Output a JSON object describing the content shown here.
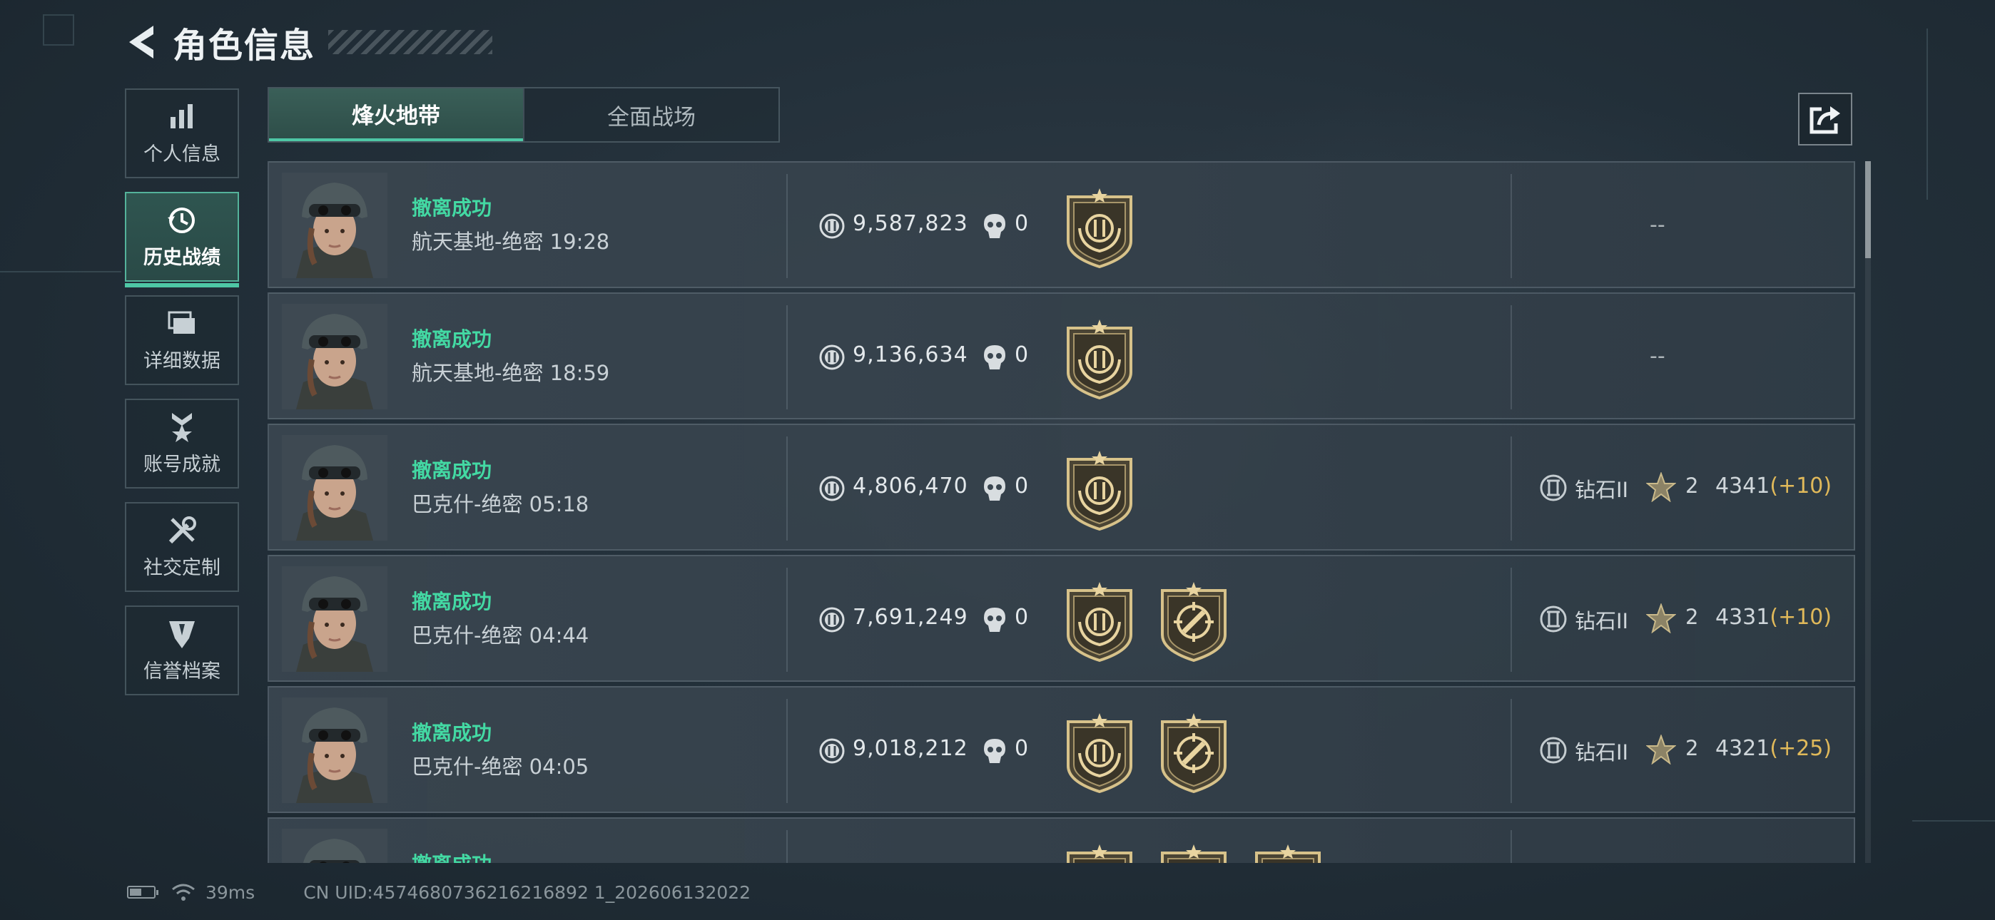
{
  "header": {
    "title": "角色信息",
    "back_icon": "back-arrow-icon"
  },
  "sidebar": {
    "items": [
      {
        "label": "个人信息",
        "icon": "bar-chart-icon",
        "active": false
      },
      {
        "label": "历史战绩",
        "icon": "history-clock-icon",
        "active": true
      },
      {
        "label": "详细数据",
        "icon": "folder-stack-icon",
        "active": false
      },
      {
        "label": "账号成就",
        "icon": "achievement-medal-icon",
        "active": false
      },
      {
        "label": "社交定制",
        "icon": "tools-icon",
        "active": false
      },
      {
        "label": "信誉档案",
        "icon": "credit-shield-icon",
        "active": false
      }
    ]
  },
  "tabs": [
    {
      "label": "烽火地带",
      "active": true
    },
    {
      "label": "全面战场",
      "active": false
    }
  ],
  "share_icon": "share-export-icon",
  "records": [
    {
      "status": "撤离成功",
      "map": "航天基地-绝密 19:28",
      "money": "9,587,823",
      "kills": "0",
      "medals": [
        "laurel-medal"
      ],
      "rank": null,
      "dash": "--"
    },
    {
      "status": "撤离成功",
      "map": "航天基地-绝密 18:59",
      "money": "9,136,634",
      "kills": "0",
      "medals": [
        "laurel-medal"
      ],
      "rank": null,
      "dash": "--"
    },
    {
      "status": "撤离成功",
      "map": "巴克什-绝密 05:18",
      "money": "4,806,470",
      "kills": "0",
      "medals": [
        "laurel-medal"
      ],
      "rank": {
        "name": "钻石II",
        "stars": "2",
        "score": "4341",
        "delta": "(+10)"
      }
    },
    {
      "status": "撤离成功",
      "map": "巴克什-绝密 04:44",
      "money": "7,691,249",
      "kills": "0",
      "medals": [
        "laurel-medal",
        "crosshair-medal"
      ],
      "rank": {
        "name": "钻石II",
        "stars": "2",
        "score": "4331",
        "delta": "(+10)"
      }
    },
    {
      "status": "撤离成功",
      "map": "巴克什-绝密 04:05",
      "money": "9,018,212",
      "kills": "0",
      "medals": [
        "laurel-medal",
        "crosshair-medal"
      ],
      "rank": {
        "name": "钻石II",
        "stars": "2",
        "score": "4321",
        "delta": "(+25)"
      }
    },
    {
      "status": "撤离成功",
      "map": "",
      "money": "",
      "kills": "",
      "medals": [
        "laurel-medal",
        "crosshair-medal",
        "star-medal"
      ],
      "rank": null,
      "dash": "",
      "partial": true
    }
  ],
  "statusbar": {
    "ping": "39ms",
    "uid": "CN UID:4574680736216216892 1_202606132022"
  },
  "colors": {
    "accent": "#4ec7a5",
    "success": "#43d9a3",
    "delta": "#e0b95a"
  }
}
